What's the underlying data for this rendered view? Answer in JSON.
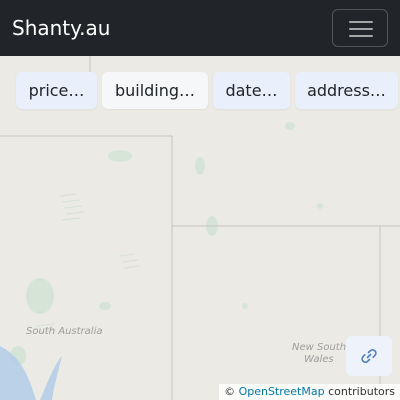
{
  "app": {
    "brand": "Shanty.au",
    "menu_icon": "hamburger-icon"
  },
  "filters": [
    {
      "label": "price…",
      "active": false
    },
    {
      "label": "building…",
      "active": true
    },
    {
      "label": "date…",
      "active": false
    },
    {
      "label": "address…",
      "active": false
    }
  ],
  "map": {
    "labels": {
      "south_australia": "South Australia",
      "nsw_line1": "New South",
      "nsw_line2": "Wales"
    },
    "share_icon": "link-icon",
    "attribution": {
      "prefix": "©",
      "link_text": "OpenStreetMap",
      "suffix": "contributors"
    }
  },
  "colors": {
    "navbar": "#212529",
    "map_land": "#eceae5",
    "vegetation": "#cfe3d3",
    "water": "#aecbe8",
    "button_bg": "#e9f0fb",
    "link": "#0078a8"
  }
}
